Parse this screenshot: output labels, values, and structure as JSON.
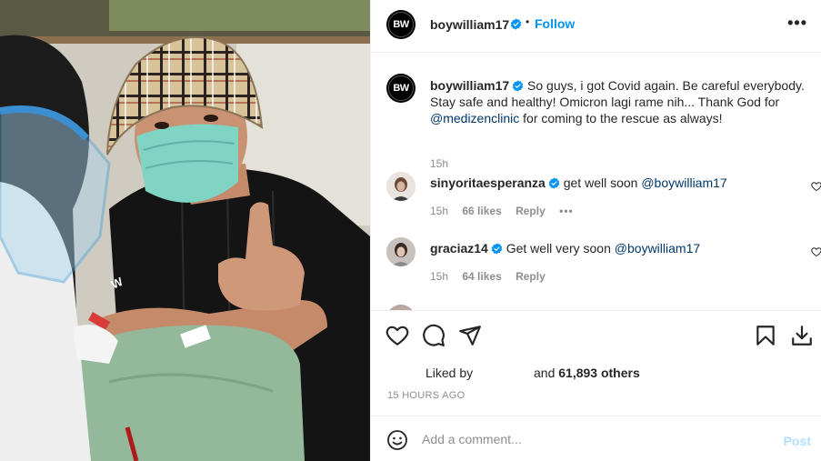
{
  "post": {
    "username": "boywilliam17",
    "avatar_text": "BW",
    "dot": "•",
    "follow_label": "Follow",
    "more_label": "•••"
  },
  "caption": {
    "username": "boywilliam17",
    "text_before": "So guys, i got Covid again. Be careful everybody. Stay safe and healthy! Omicron lagi rame nih... Thank God for",
    "mention": "@medizenclinic",
    "text_after": "for coming to the rescue as always!",
    "time": "15h"
  },
  "comments": [
    {
      "username": "sinyoritaesperanza",
      "text": "get well soon",
      "mention": "@boywilliam17",
      "time": "15h",
      "likes": "66 likes",
      "reply": "Reply",
      "more": "•••"
    },
    {
      "username": "graciaz14",
      "text": "Get well very soon",
      "mention": "@boywilliam17",
      "time": "15h",
      "likes": "64 likes",
      "reply": "Reply"
    }
  ],
  "likes": {
    "liked_by": "Liked by",
    "and_label": "and",
    "others": "61,893 others"
  },
  "timestamp": "15 HOURS AGO",
  "add_comment": {
    "placeholder": "Add a comment...",
    "post_label": "Post"
  },
  "colors": {
    "accent": "#0095f6",
    "post_disabled": "#b2dffc",
    "mention": "#00376b",
    "muted": "#8e8e8e"
  },
  "icons": [
    "heart-icon",
    "comment-icon",
    "share-icon",
    "bookmark-icon",
    "download-icon",
    "emoji-icon",
    "verified-badge-icon",
    "more-options-icon"
  ]
}
